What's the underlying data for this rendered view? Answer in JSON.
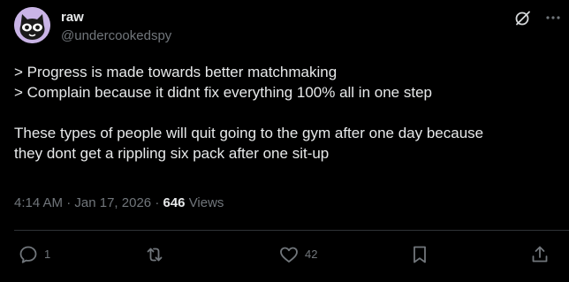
{
  "author": {
    "display_name": "raw",
    "handle": "@undercookedspy",
    "avatar_icon": "cat-avatar-icon"
  },
  "post": {
    "lines_block1": [
      "> Progress is made towards better matchmaking",
      "> Complain because it didnt fix everything 100% all in one step"
    ],
    "lines_block2": [
      "These types of people will quit going to the gym after one day because",
      "they dont get a rippling six pack after one sit-up"
    ]
  },
  "meta": {
    "time": "4:14 AM",
    "separator": "·",
    "date": "Jan 17, 2026",
    "views_count": "646",
    "views_label": "Views"
  },
  "actions": {
    "replies": "1",
    "reposts": "",
    "likes": "42",
    "bookmarks": "",
    "share": ""
  },
  "colors": {
    "background": "#000000",
    "text_primary": "#e7e9ea",
    "text_secondary": "#71767b",
    "divider": "#2f3336",
    "avatar_bg": "#c9b4e6"
  },
  "icons": {
    "grok": "grok-icon",
    "more": "more-icon",
    "reply": "reply-icon",
    "repost": "repost-icon",
    "like": "heart-icon",
    "bookmark": "bookmark-icon",
    "share": "share-icon"
  }
}
